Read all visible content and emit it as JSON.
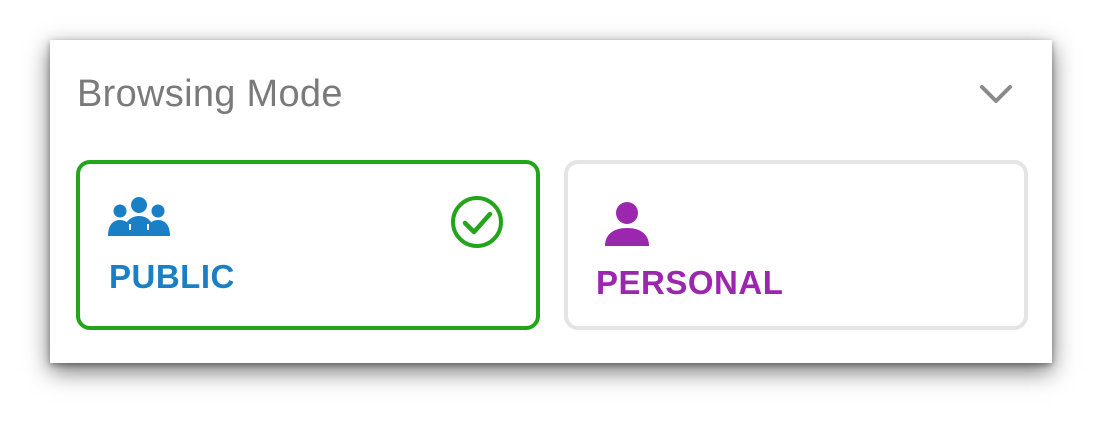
{
  "panel": {
    "title": "Browsing Mode",
    "collapse_icon": "chevron-down-icon"
  },
  "options": [
    {
      "label": "PUBLIC",
      "icon": "group-icon",
      "color": "#1a7fc4",
      "selected": true,
      "selected_icon": "check-circle-icon",
      "selected_color": "#22a51b"
    },
    {
      "label": "PERSONAL",
      "icon": "person-icon",
      "color": "#9a27ae",
      "selected": false
    }
  ]
}
